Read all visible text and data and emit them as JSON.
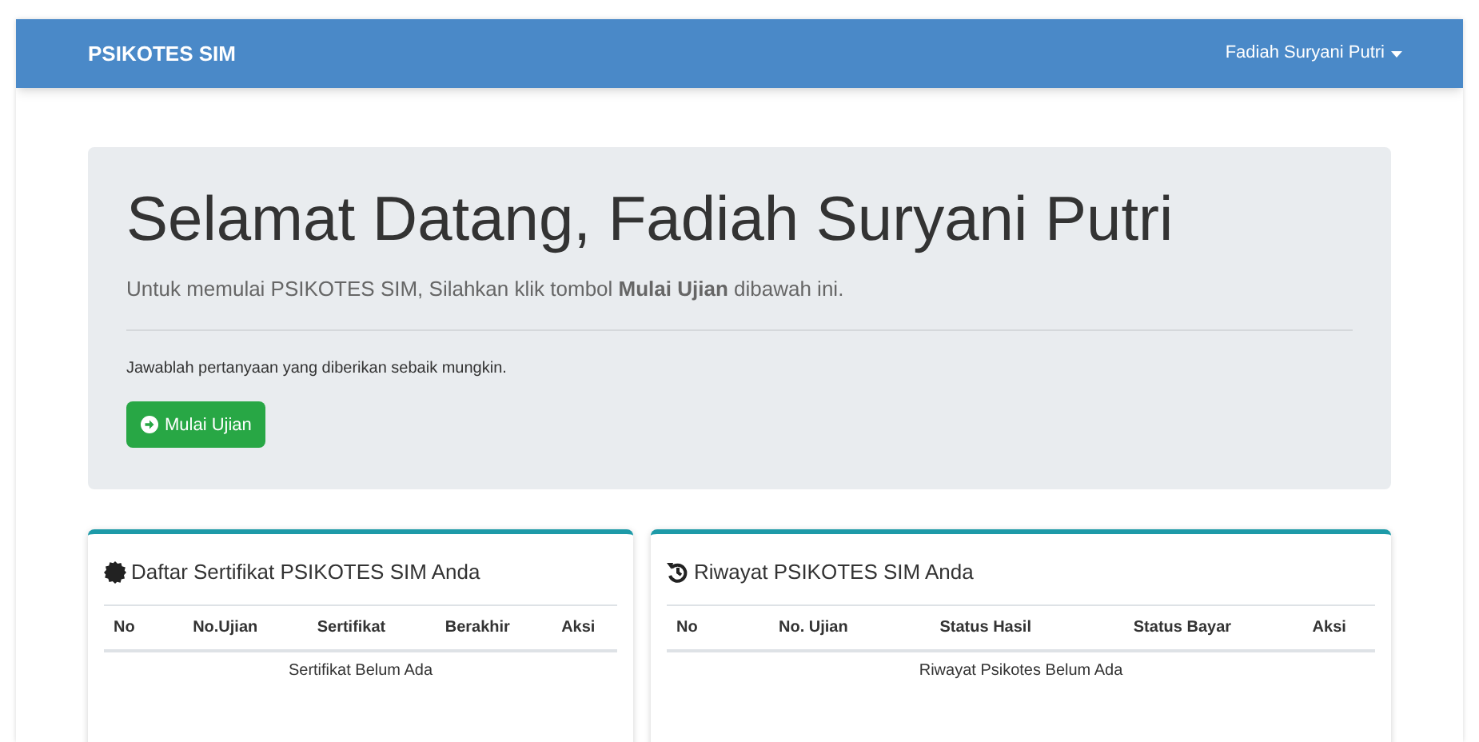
{
  "navbar": {
    "brand": "PSIKOTES SIM",
    "user_menu": "Fadiah Suryani Putri"
  },
  "jumbotron": {
    "title": "Selamat Datang, Fadiah Suryani Putri",
    "lead": "Untuk memulai PSIKOTES SIM, Silahkan klik tombol **Mulai Ujian** dibawah ini.",
    "note": "Jawablah pertanyaan yang diberikan sebaik mungkin.",
    "button": "Mulai Ujian"
  },
  "cards": [
    {
      "kind": "certificate",
      "title": "Daftar Sertifikat PSIKOTES SIM Anda",
      "columns": [
        "No",
        "No.Ujian",
        "Sertifikat",
        "Berakhir",
        "Aksi"
      ],
      "empty_message": "Sertifikat Belum Ada"
    },
    {
      "kind": "history",
      "title": "Riwayat PSIKOTES SIM Anda",
      "columns": [
        "No",
        "No. Ujian",
        "Status Hasil",
        "Status Bayar",
        "Aksi"
      ],
      "empty_message": "Riwayat Psikotes Belum Ada"
    }
  ]
}
